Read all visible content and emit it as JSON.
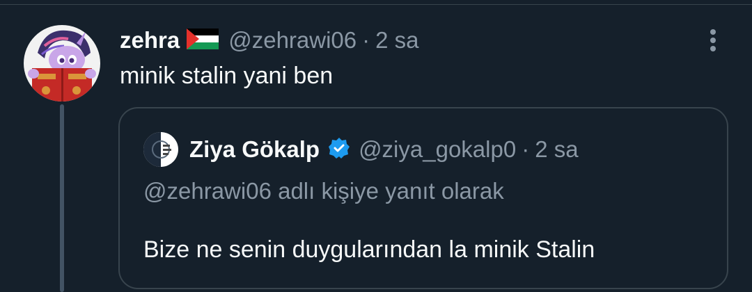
{
  "colors": {
    "background": "#15202b",
    "text_primary": "#f7f9f9",
    "text_secondary": "#8b98a5",
    "border": "#38444d",
    "verified": "#1d9bf0"
  },
  "tweet": {
    "display_name": "zehra",
    "name_flag_icon": "palestine-flag-icon",
    "handle": "@zehrawi06",
    "separator": "·",
    "time": "2 sa",
    "text": "minik stalin yani ben",
    "more_icon": "more-vertical-icon"
  },
  "quoted_tweet": {
    "display_name": "Ziya Gökalp",
    "verified_icon": "verified-badge-icon",
    "handle": "@ziya_gokalp0",
    "separator": "·",
    "time": "2 sa",
    "reply_context": "@zehrawi06 adlı kişiye yanıt olarak",
    "text": "Bize ne senin duygularından la minik Stalin"
  }
}
